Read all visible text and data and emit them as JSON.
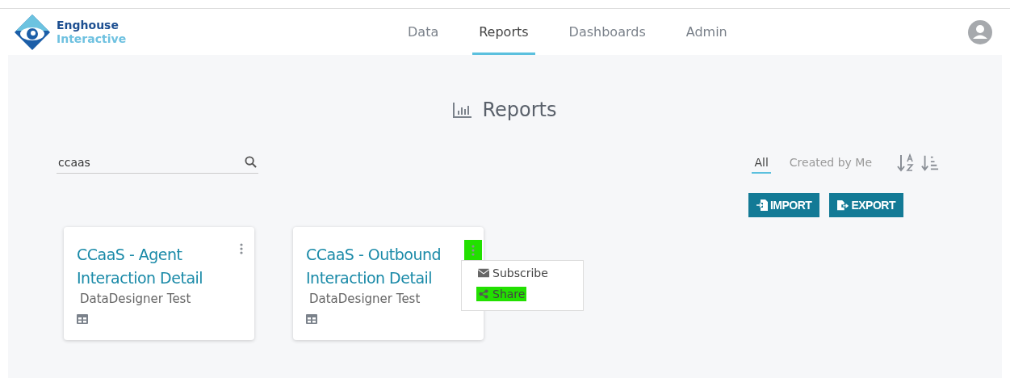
{
  "brand": {
    "line_1": "Enghouse",
    "line_2": "Interactive"
  },
  "nav": [
    {
      "label": "Data",
      "selected": false
    },
    {
      "label": "Reports",
      "selected": true
    },
    {
      "label": "Dashboards",
      "selected": false
    },
    {
      "label": "Admin",
      "selected": false
    }
  ],
  "page_title": "Reports",
  "search": {
    "value": "ccaas"
  },
  "filters": [
    {
      "label": "All",
      "selected": true
    },
    {
      "label": "Created by Me",
      "selected": false
    }
  ],
  "buttons": [
    {
      "label": "IMPORT",
      "kind": "import"
    },
    {
      "label": "EXPORT",
      "kind": "export"
    }
  ],
  "cards": [
    {
      "title": "CCaaS - Agent Interaction Detail",
      "owner": "DataDesigner Test",
      "menu_highlighted": false
    },
    {
      "title": "CCaaS - Outbound Interaction Detail",
      "owner": "DataDesigner Test",
      "menu_highlighted": true,
      "menu": [
        {
          "label": "Subscribe",
          "kind": "subscribe",
          "highlighted": false
        },
        {
          "label": "Share",
          "kind": "share",
          "highlighted": true
        }
      ]
    }
  ]
}
